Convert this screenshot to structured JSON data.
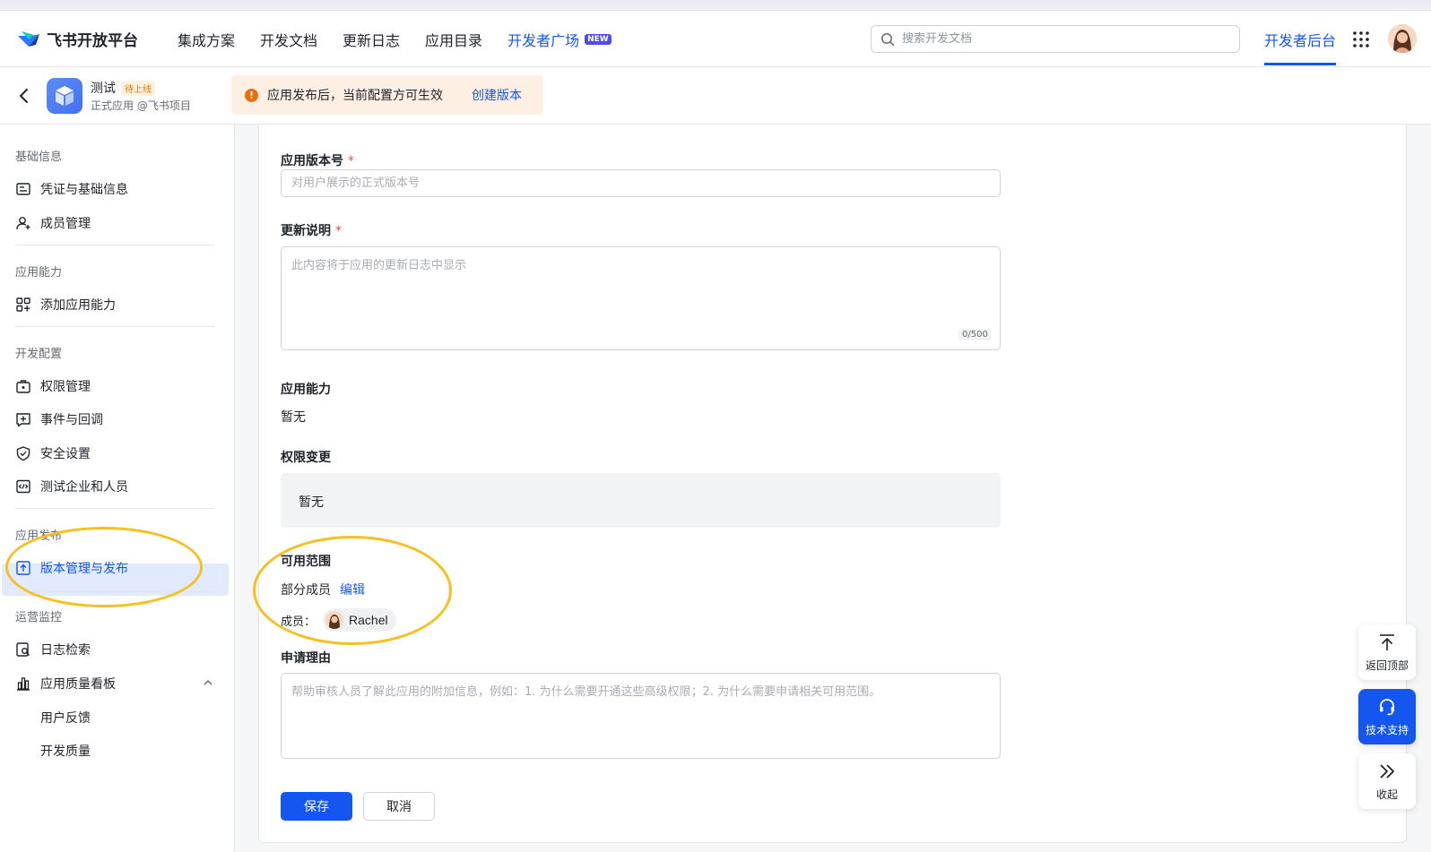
{
  "header": {
    "logo_text": "飞书开放平台",
    "nav": [
      "集成方案",
      "开发文档",
      "更新日志",
      "应用目录"
    ],
    "nav_highlight": "开发者广场",
    "new_badge": "NEW",
    "search_placeholder": "搜索开发文档",
    "console_label": "开发者后台"
  },
  "app": {
    "name": "测试",
    "status": "待上线",
    "subtitle": "正式应用 @飞书项目",
    "notice_text": "应用发布后，当前配置方可生效",
    "notice_link": "创建版本"
  },
  "sidebar": {
    "groups": [
      {
        "title": "基础信息",
        "items": [
          "凭证与基础信息",
          "成员管理"
        ]
      },
      {
        "title": "应用能力",
        "items": [
          "添加应用能力"
        ]
      },
      {
        "title": "开发配置",
        "items": [
          "权限管理",
          "事件与回调",
          "安全设置",
          "测试企业和人员"
        ]
      },
      {
        "title": "应用发布",
        "items": [
          "版本管理与发布"
        ]
      },
      {
        "title": "运营监控",
        "items": [
          "日志检索",
          "应用质量看板"
        ],
        "subitems": [
          "用户反馈",
          "开发质量"
        ]
      }
    ]
  },
  "form": {
    "version_label": "应用版本号",
    "version_placeholder": "对用户展示的正式版本号",
    "notes_label": "更新说明",
    "notes_placeholder": "此内容将于应用的更新日志中显示",
    "notes_counter": "0/500",
    "capability_label": "应用能力",
    "capability_value": "暂无",
    "permission_label": "权限变更",
    "permission_value": "暂无",
    "scope_label": "可用范围",
    "scope_value": "部分成员",
    "scope_edit": "编辑",
    "members_label": "成员：",
    "member_name": "Rachel",
    "reason_label": "申请理由",
    "reason_placeholder": "帮助审核人员了解此应用的附加信息，例如：1. 为什么需要开通这些高级权限；2. 为什么需要申请相关可用范围。",
    "required_mark": "*",
    "save_label": "保存",
    "cancel_label": "取消"
  },
  "float": {
    "top_label": "返回顶部",
    "support_label": "技术支持",
    "collapse_label": "收起"
  },
  "colors": {
    "primary": "#1456f0",
    "annotation": "#f6c022",
    "warning": "#ed6d0c"
  }
}
